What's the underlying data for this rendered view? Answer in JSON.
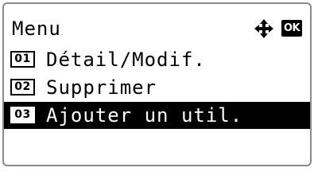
{
  "header": {
    "title": "Menu",
    "nav_icon": "four-way-arrow-icon",
    "ok_label": "OK"
  },
  "menu": {
    "items": [
      {
        "number": "01",
        "label": "Détail/Modif.",
        "selected": false
      },
      {
        "number": "02",
        "label": "Supprimer",
        "selected": false
      },
      {
        "number": "03",
        "label": "Ajouter un util.",
        "selected": true
      }
    ]
  },
  "colors": {
    "background": "#ffffff",
    "text": "#000000",
    "selection": "#000000",
    "frame": "#8a8a8a"
  }
}
